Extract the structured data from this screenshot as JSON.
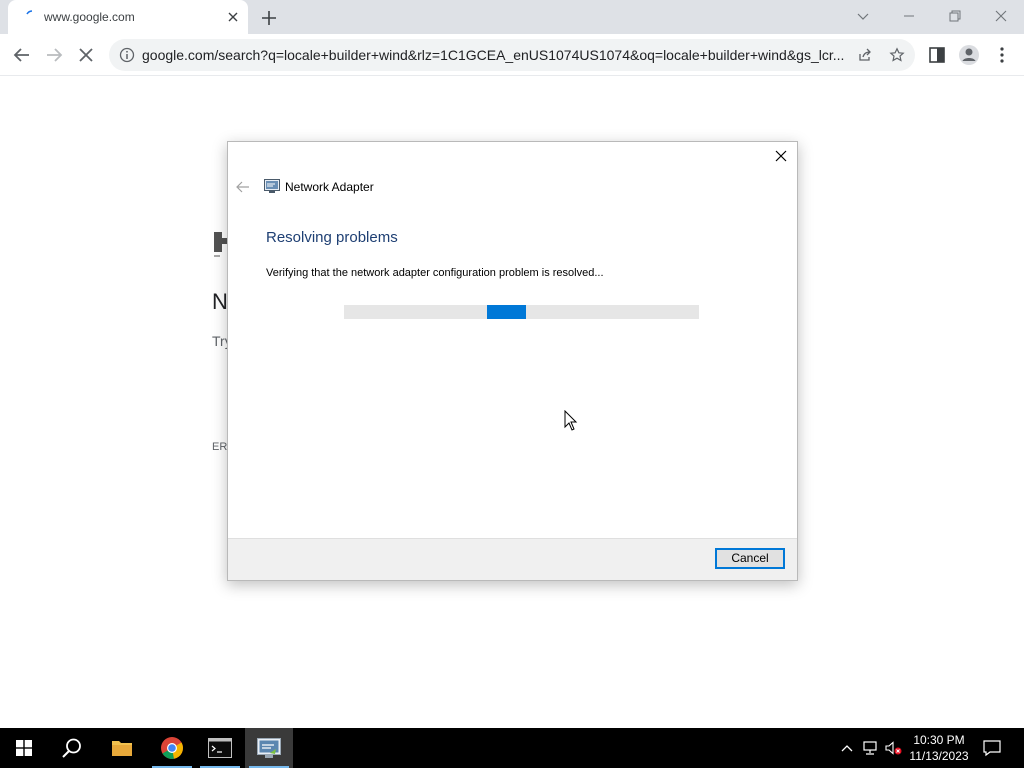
{
  "browser": {
    "tab_title": "www.google.com",
    "address": "google.com/search?q=locale+builder+wind&rlz=1C1GCEA_enUS1074US1074&oq=locale+builder+wind&gs_lcr...",
    "icons": [
      "back-arrow-icon",
      "forward-arrow-icon",
      "stop-loading-icon",
      "info-icon",
      "share-icon",
      "star-icon",
      "side-panel-icon",
      "profile-icon",
      "more-menu-icon"
    ]
  },
  "background_page": {
    "heading_fragment": "N",
    "text_fragment": "Try",
    "error_fragment": "ERI"
  },
  "dialog": {
    "app_title": "Network Adapter",
    "heading": "Resolving problems",
    "description": "Verifying that the network adapter configuration problem is resolved...",
    "cancel_label": "Cancel",
    "progress_state": "indeterminate",
    "accent_color": "#0078d7",
    "heading_color": "#1e3f73"
  },
  "taskbar": {
    "apps": [
      "start",
      "search",
      "file-explorer",
      "chrome",
      "terminal",
      "network-troubleshooter"
    ],
    "time": "10:30 PM",
    "date": "11/13/2023"
  }
}
